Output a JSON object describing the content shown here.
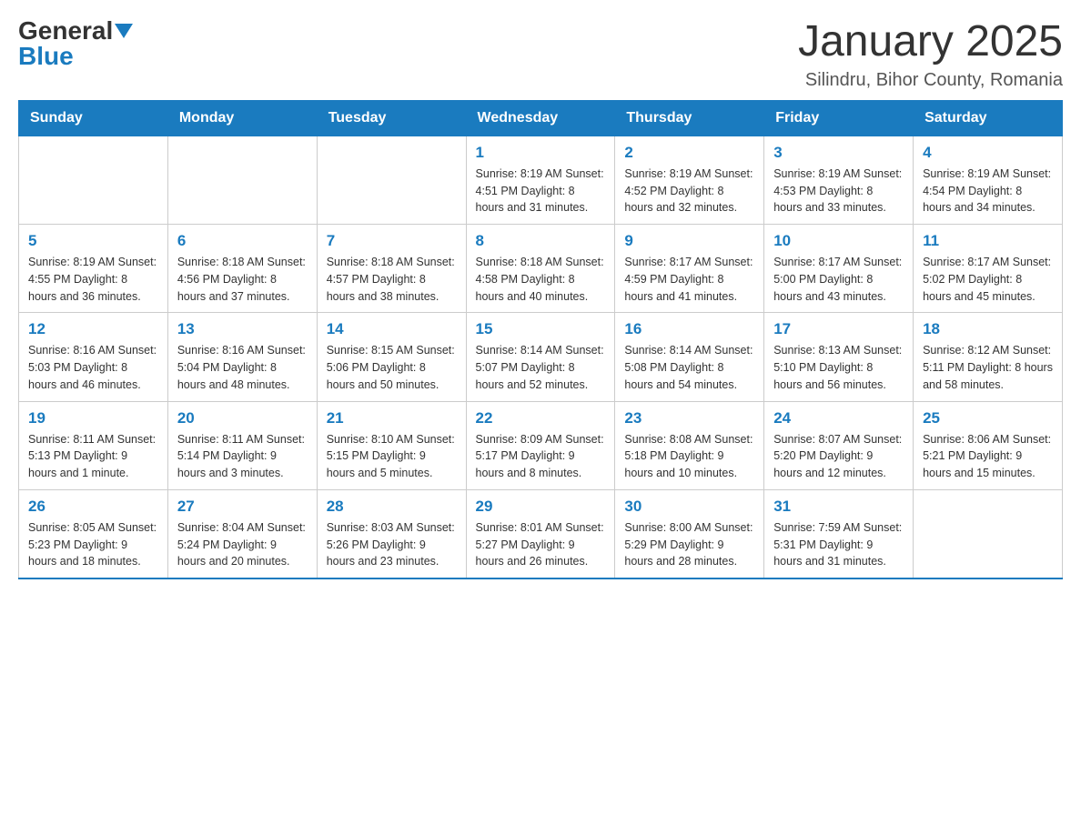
{
  "logo": {
    "general": "General",
    "blue": "Blue"
  },
  "title": "January 2025",
  "subtitle": "Silindru, Bihor County, Romania",
  "headers": [
    "Sunday",
    "Monday",
    "Tuesday",
    "Wednesday",
    "Thursday",
    "Friday",
    "Saturday"
  ],
  "weeks": [
    [
      {
        "day": "",
        "info": ""
      },
      {
        "day": "",
        "info": ""
      },
      {
        "day": "",
        "info": ""
      },
      {
        "day": "1",
        "info": "Sunrise: 8:19 AM\nSunset: 4:51 PM\nDaylight: 8 hours\nand 31 minutes."
      },
      {
        "day": "2",
        "info": "Sunrise: 8:19 AM\nSunset: 4:52 PM\nDaylight: 8 hours\nand 32 minutes."
      },
      {
        "day": "3",
        "info": "Sunrise: 8:19 AM\nSunset: 4:53 PM\nDaylight: 8 hours\nand 33 minutes."
      },
      {
        "day": "4",
        "info": "Sunrise: 8:19 AM\nSunset: 4:54 PM\nDaylight: 8 hours\nand 34 minutes."
      }
    ],
    [
      {
        "day": "5",
        "info": "Sunrise: 8:19 AM\nSunset: 4:55 PM\nDaylight: 8 hours\nand 36 minutes."
      },
      {
        "day": "6",
        "info": "Sunrise: 8:18 AM\nSunset: 4:56 PM\nDaylight: 8 hours\nand 37 minutes."
      },
      {
        "day": "7",
        "info": "Sunrise: 8:18 AM\nSunset: 4:57 PM\nDaylight: 8 hours\nand 38 minutes."
      },
      {
        "day": "8",
        "info": "Sunrise: 8:18 AM\nSunset: 4:58 PM\nDaylight: 8 hours\nand 40 minutes."
      },
      {
        "day": "9",
        "info": "Sunrise: 8:17 AM\nSunset: 4:59 PM\nDaylight: 8 hours\nand 41 minutes."
      },
      {
        "day": "10",
        "info": "Sunrise: 8:17 AM\nSunset: 5:00 PM\nDaylight: 8 hours\nand 43 minutes."
      },
      {
        "day": "11",
        "info": "Sunrise: 8:17 AM\nSunset: 5:02 PM\nDaylight: 8 hours\nand 45 minutes."
      }
    ],
    [
      {
        "day": "12",
        "info": "Sunrise: 8:16 AM\nSunset: 5:03 PM\nDaylight: 8 hours\nand 46 minutes."
      },
      {
        "day": "13",
        "info": "Sunrise: 8:16 AM\nSunset: 5:04 PM\nDaylight: 8 hours\nand 48 minutes."
      },
      {
        "day": "14",
        "info": "Sunrise: 8:15 AM\nSunset: 5:06 PM\nDaylight: 8 hours\nand 50 minutes."
      },
      {
        "day": "15",
        "info": "Sunrise: 8:14 AM\nSunset: 5:07 PM\nDaylight: 8 hours\nand 52 minutes."
      },
      {
        "day": "16",
        "info": "Sunrise: 8:14 AM\nSunset: 5:08 PM\nDaylight: 8 hours\nand 54 minutes."
      },
      {
        "day": "17",
        "info": "Sunrise: 8:13 AM\nSunset: 5:10 PM\nDaylight: 8 hours\nand 56 minutes."
      },
      {
        "day": "18",
        "info": "Sunrise: 8:12 AM\nSunset: 5:11 PM\nDaylight: 8 hours\nand 58 minutes."
      }
    ],
    [
      {
        "day": "19",
        "info": "Sunrise: 8:11 AM\nSunset: 5:13 PM\nDaylight: 9 hours\nand 1 minute."
      },
      {
        "day": "20",
        "info": "Sunrise: 8:11 AM\nSunset: 5:14 PM\nDaylight: 9 hours\nand 3 minutes."
      },
      {
        "day": "21",
        "info": "Sunrise: 8:10 AM\nSunset: 5:15 PM\nDaylight: 9 hours\nand 5 minutes."
      },
      {
        "day": "22",
        "info": "Sunrise: 8:09 AM\nSunset: 5:17 PM\nDaylight: 9 hours\nand 8 minutes."
      },
      {
        "day": "23",
        "info": "Sunrise: 8:08 AM\nSunset: 5:18 PM\nDaylight: 9 hours\nand 10 minutes."
      },
      {
        "day": "24",
        "info": "Sunrise: 8:07 AM\nSunset: 5:20 PM\nDaylight: 9 hours\nand 12 minutes."
      },
      {
        "day": "25",
        "info": "Sunrise: 8:06 AM\nSunset: 5:21 PM\nDaylight: 9 hours\nand 15 minutes."
      }
    ],
    [
      {
        "day": "26",
        "info": "Sunrise: 8:05 AM\nSunset: 5:23 PM\nDaylight: 9 hours\nand 18 minutes."
      },
      {
        "day": "27",
        "info": "Sunrise: 8:04 AM\nSunset: 5:24 PM\nDaylight: 9 hours\nand 20 minutes."
      },
      {
        "day": "28",
        "info": "Sunrise: 8:03 AM\nSunset: 5:26 PM\nDaylight: 9 hours\nand 23 minutes."
      },
      {
        "day": "29",
        "info": "Sunrise: 8:01 AM\nSunset: 5:27 PM\nDaylight: 9 hours\nand 26 minutes."
      },
      {
        "day": "30",
        "info": "Sunrise: 8:00 AM\nSunset: 5:29 PM\nDaylight: 9 hours\nand 28 minutes."
      },
      {
        "day": "31",
        "info": "Sunrise: 7:59 AM\nSunset: 5:31 PM\nDaylight: 9 hours\nand 31 minutes."
      },
      {
        "day": "",
        "info": ""
      }
    ]
  ]
}
